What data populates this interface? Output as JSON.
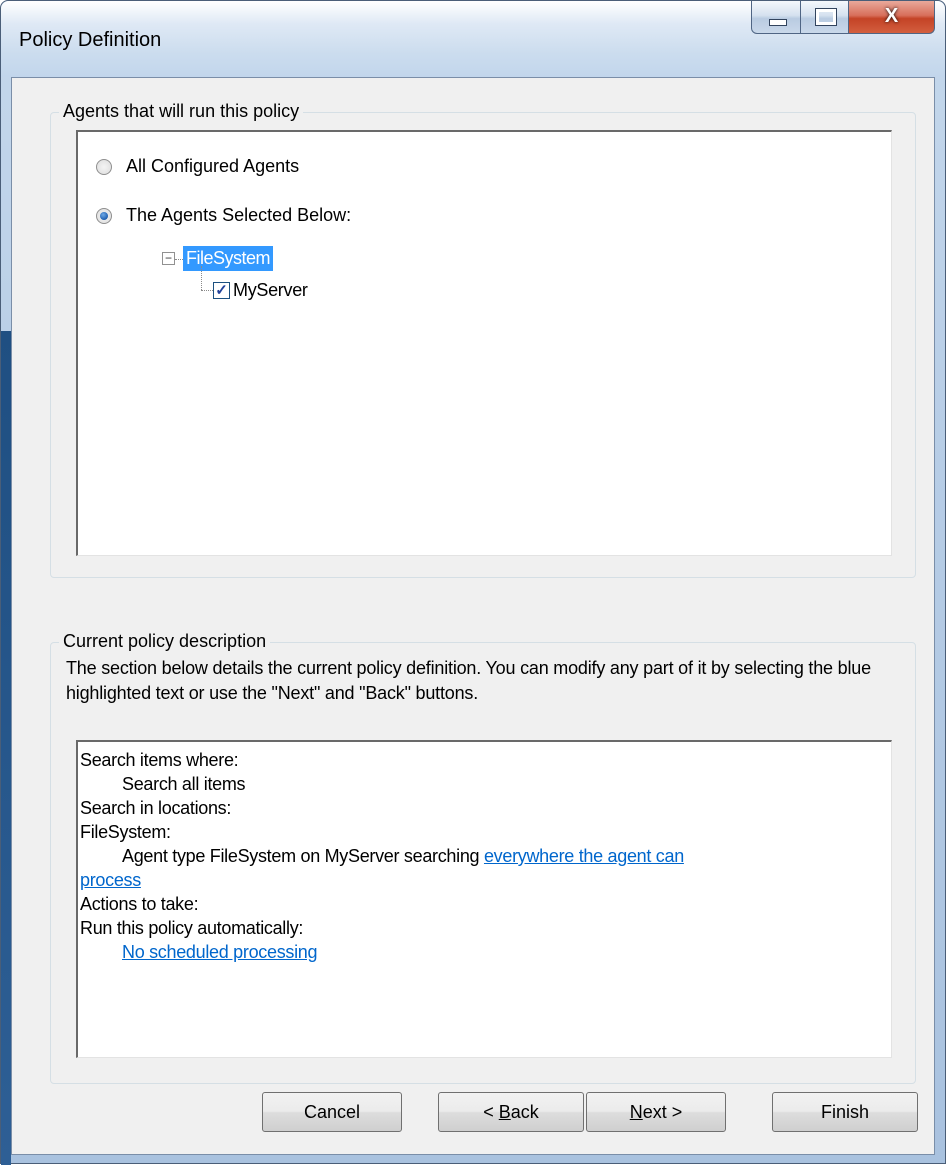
{
  "window": {
    "title": "Policy Definition",
    "close_glyph": "X"
  },
  "agents_group": {
    "legend": "Agents that will run this policy",
    "radio_all": "All Configured Agents",
    "radio_selected": "The Agents Selected Below:",
    "selected_option": "The Agents Selected Below:",
    "tree": {
      "root_label": "FileSystem",
      "root_expander": "−",
      "child_label": "MyServer",
      "child_checked": true,
      "check_glyph": "✓"
    }
  },
  "description_group": {
    "legend": "Current policy description",
    "intro": "The section below details the current policy definition. You can modify any part of it by selecting the blue highlighted text or use the \"Next\" and \"Back\" buttons.",
    "lines": {
      "search_items_where": "Search items where:",
      "search_all_items": "Search all items",
      "search_in_locations": "Search in locations:",
      "filesystem": "FileSystem:",
      "agent_type_prefix": "Agent type FileSystem on MyServer searching ",
      "agent_link_part1": "everywhere the agent can",
      "agent_link_part2": "process",
      "actions_to_take": "Actions to take:",
      "run_automatically": "Run this policy automatically:",
      "schedule_link": "No scheduled processing"
    }
  },
  "buttons": {
    "cancel": "Cancel",
    "back_prefix": "< ",
    "back_mnemonic": "B",
    "back_rest": "ack",
    "next_mnemonic": "N",
    "next_rest": "ext >",
    "finish": "Finish"
  },
  "colors": {
    "selection_blue": "#3399ff",
    "link_blue": "#0066cc",
    "dialog_bg": "#f0f0f0"
  }
}
